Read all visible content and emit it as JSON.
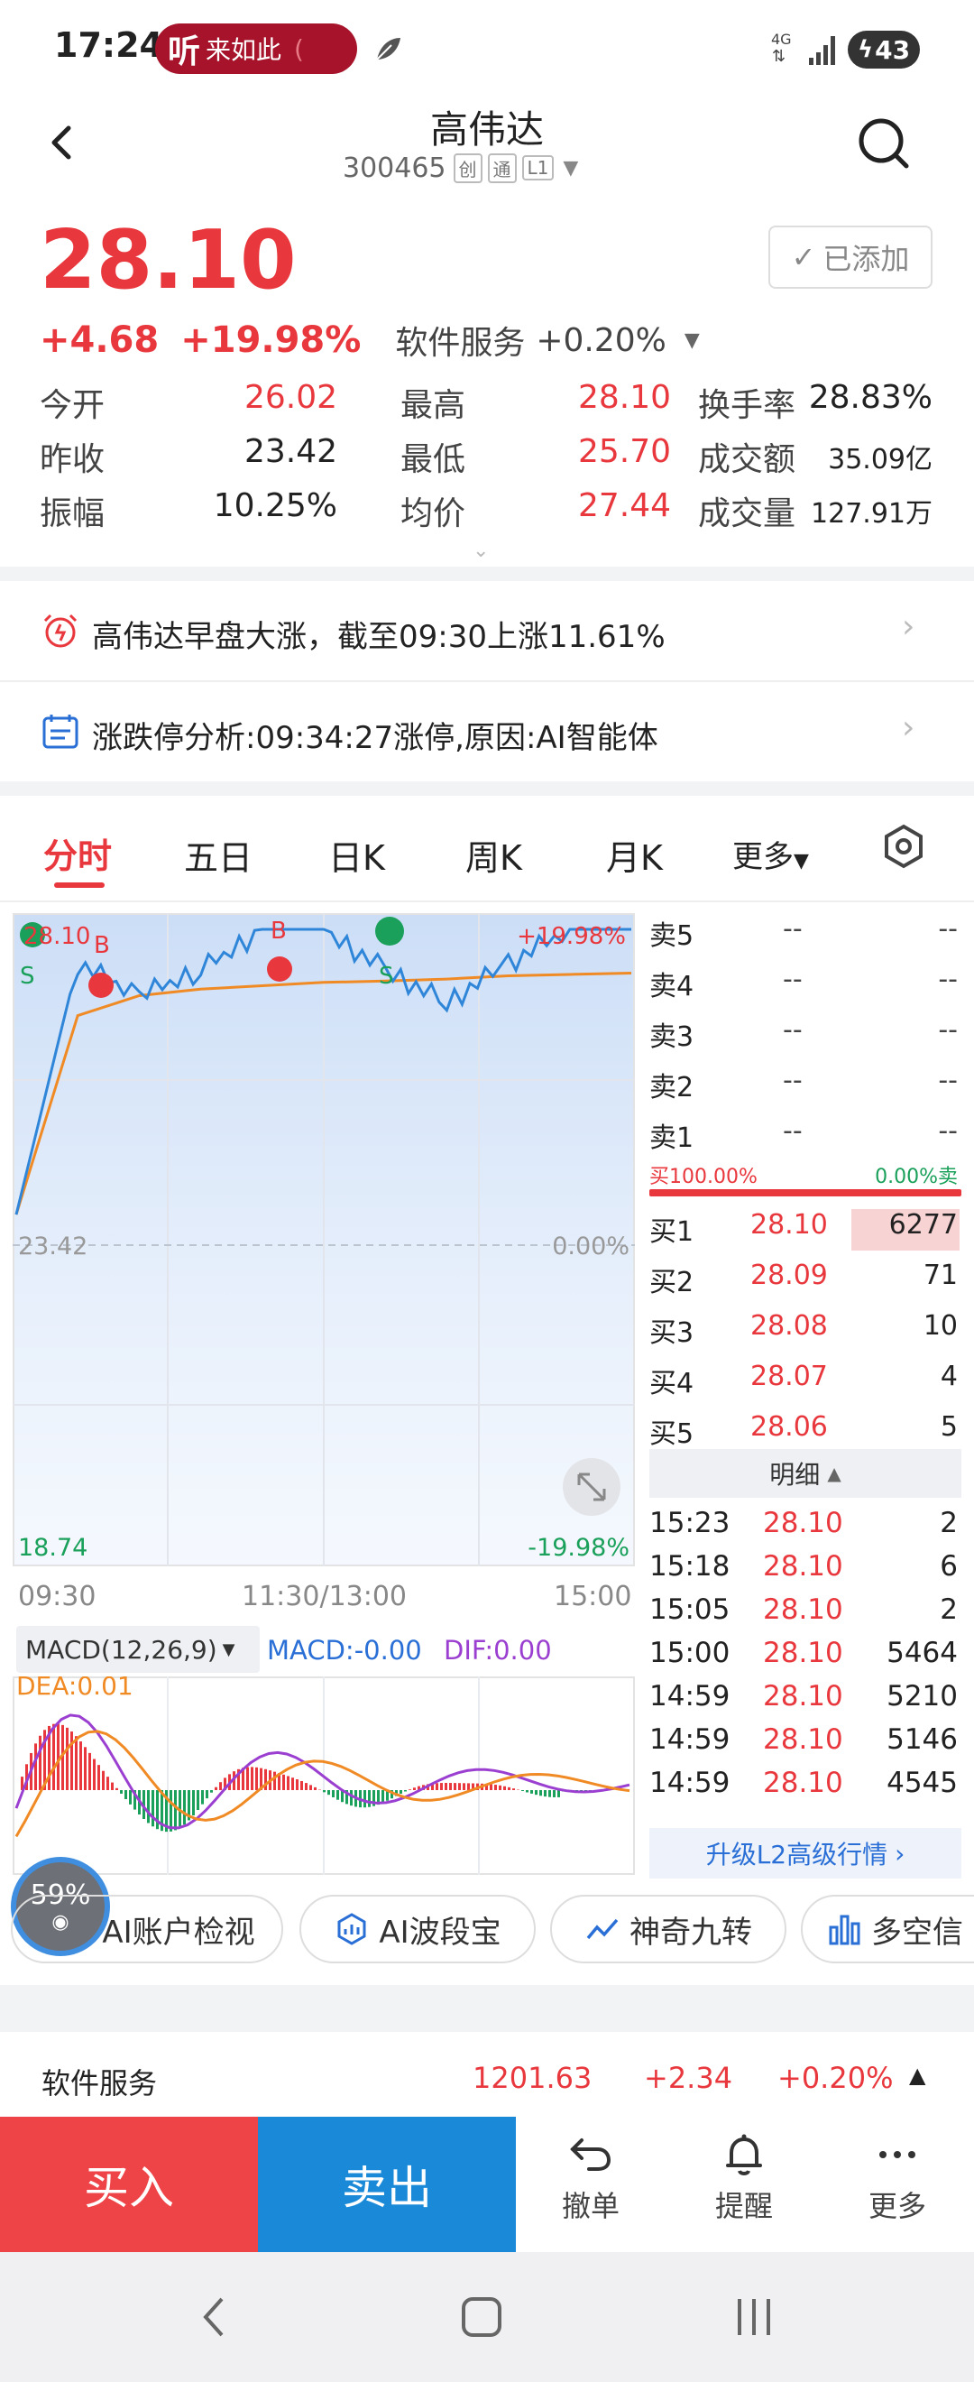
{
  "status_bar": {
    "time": "17:24",
    "app_pill": "来如此",
    "app_glyph": "听",
    "app_tail": "(",
    "network": "4G",
    "battery": "43"
  },
  "header": {
    "title": "高伟达",
    "code": "300465",
    "tags": [
      "创",
      "通",
      "L1"
    ]
  },
  "quote": {
    "price": "28.10",
    "change": "+4.68",
    "change_pct": "+19.98%",
    "sector": "软件服务",
    "sector_pct": "+0.20%",
    "added_label": "已添加",
    "stats": [
      [
        {
          "label": "今开",
          "value": "26.02",
          "color": "red"
        },
        {
          "label": "最高",
          "value": "28.10",
          "color": "red"
        },
        {
          "label": "换手率",
          "value": "28.83%",
          "color": "dark"
        }
      ],
      [
        {
          "label": "昨收",
          "value": "23.42",
          "color": "dark"
        },
        {
          "label": "最低",
          "value": "25.70",
          "color": "red"
        },
        {
          "label": "成交额",
          "value": "35.09亿",
          "color": "dark"
        }
      ],
      [
        {
          "label": "振幅",
          "value": "10.25%",
          "color": "dark"
        },
        {
          "label": "均价",
          "value": "27.44",
          "color": "red"
        },
        {
          "label": "成交量",
          "value": "127.91万",
          "color": "dark"
        }
      ]
    ]
  },
  "news": [
    {
      "text": "高伟达早盘大涨，截至09:30上涨11.61%"
    },
    {
      "text": "涨跌停分析:09:34:27涨停,原因:AI智能体"
    }
  ],
  "tabs": [
    "分时",
    "五日",
    "日K",
    "周K",
    "月K",
    "更多"
  ],
  "chart": {
    "top_left_label": "28.10",
    "top_right_pct": "+19.98%",
    "mid_price": "23.42",
    "mid_pct": "0.00%",
    "bottom_price": "18.74",
    "bottom_pct": "-19.98%",
    "time_labels": [
      "09:30",
      "11:30/13:00",
      "15:00"
    ],
    "markers": [
      "S",
      "B",
      "B",
      "S"
    ],
    "macd_selector": "MACD(12,26,9)",
    "macd_value": "MACD:-0.00",
    "dif_value": "DIF:0.00",
    "dea_value": "DEA:0.01",
    "progress": "59%"
  },
  "chart_data": {
    "type": "line",
    "title": "",
    "ylim": [
      18.74,
      28.1
    ],
    "x": [
      "09:30",
      "11:30/13:00",
      "15:00"
    ],
    "series": [
      {
        "values": [
          23.8,
          27.6,
          27.1,
          27.5,
          28.1,
          28.1,
          27.5,
          27.0,
          27.6,
          28.1,
          28.1
        ]
      },
      {
        "values": [
          23.8,
          26.8,
          27.1,
          27.2,
          27.25,
          27.3,
          27.32,
          27.35,
          27.4,
          27.42,
          27.44
        ]
      }
    ]
  },
  "orderbook": {
    "sell": [
      {
        "label": "卖5",
        "price": "--",
        "vol": "--"
      },
      {
        "label": "卖4",
        "price": "--",
        "vol": "--"
      },
      {
        "label": "卖3",
        "price": "--",
        "vol": "--"
      },
      {
        "label": "卖2",
        "price": "--",
        "vol": "--"
      },
      {
        "label": "卖1",
        "price": "--",
        "vol": "--"
      }
    ],
    "ratio_buy": "买100.00%",
    "ratio_sell": "0.00%卖",
    "buy": [
      {
        "label": "买1",
        "price": "28.10",
        "vol": "6277"
      },
      {
        "label": "买2",
        "price": "28.09",
        "vol": "71"
      },
      {
        "label": "买3",
        "price": "28.08",
        "vol": "10"
      },
      {
        "label": "买4",
        "price": "28.07",
        "vol": "4"
      },
      {
        "label": "买5",
        "price": "28.06",
        "vol": "5"
      }
    ],
    "detail_label": "明细",
    "ticks": [
      {
        "time": "15:23",
        "price": "28.10",
        "vol": "2"
      },
      {
        "time": "15:18",
        "price": "28.10",
        "vol": "6"
      },
      {
        "time": "15:05",
        "price": "28.10",
        "vol": "2"
      },
      {
        "time": "15:00",
        "price": "28.10",
        "vol": "5464"
      },
      {
        "time": "14:59",
        "price": "28.10",
        "vol": "5210"
      },
      {
        "time": "14:59",
        "price": "28.10",
        "vol": "5146"
      },
      {
        "time": "14:59",
        "price": "28.10",
        "vol": "4545"
      }
    ],
    "upgrade": "升级L2高级行情"
  },
  "tools": [
    "AI账户检视",
    "AI波段宝",
    "神奇九转",
    "多空信"
  ],
  "sector_bar": {
    "name": "软件服务",
    "value": "1201.63",
    "change": "+2.34",
    "pct": "+0.20%"
  },
  "bottom": {
    "buy": "买入",
    "sell": "卖出",
    "cancel": "撤单",
    "alert": "提醒",
    "more": "更多"
  }
}
